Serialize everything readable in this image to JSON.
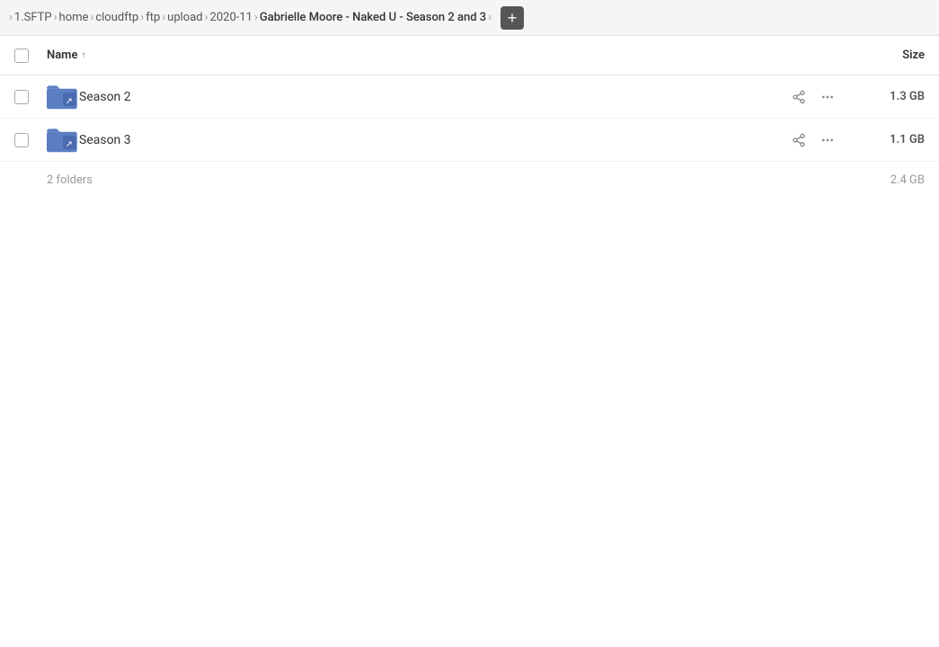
{
  "breadcrumb": {
    "items": [
      {
        "label": "1.SFTP"
      },
      {
        "label": "home"
      },
      {
        "label": "cloudftp"
      },
      {
        "label": "ftp"
      },
      {
        "label": "upload"
      },
      {
        "label": "2020-11"
      },
      {
        "label": "Gabrielle Moore - Naked U - Season 2 and 3"
      }
    ],
    "add_label": "+"
  },
  "table": {
    "header": {
      "name_label": "Name",
      "size_label": "Size"
    },
    "rows": [
      {
        "name": "Season 2",
        "size": "1.3 GB"
      },
      {
        "name": "Season 3",
        "size": "1.1 GB"
      }
    ],
    "footer": {
      "info": "2 folders",
      "total_size": "2.4 GB"
    }
  },
  "icons": {
    "share": "⤴",
    "more": "···",
    "sort_asc": "↑"
  }
}
